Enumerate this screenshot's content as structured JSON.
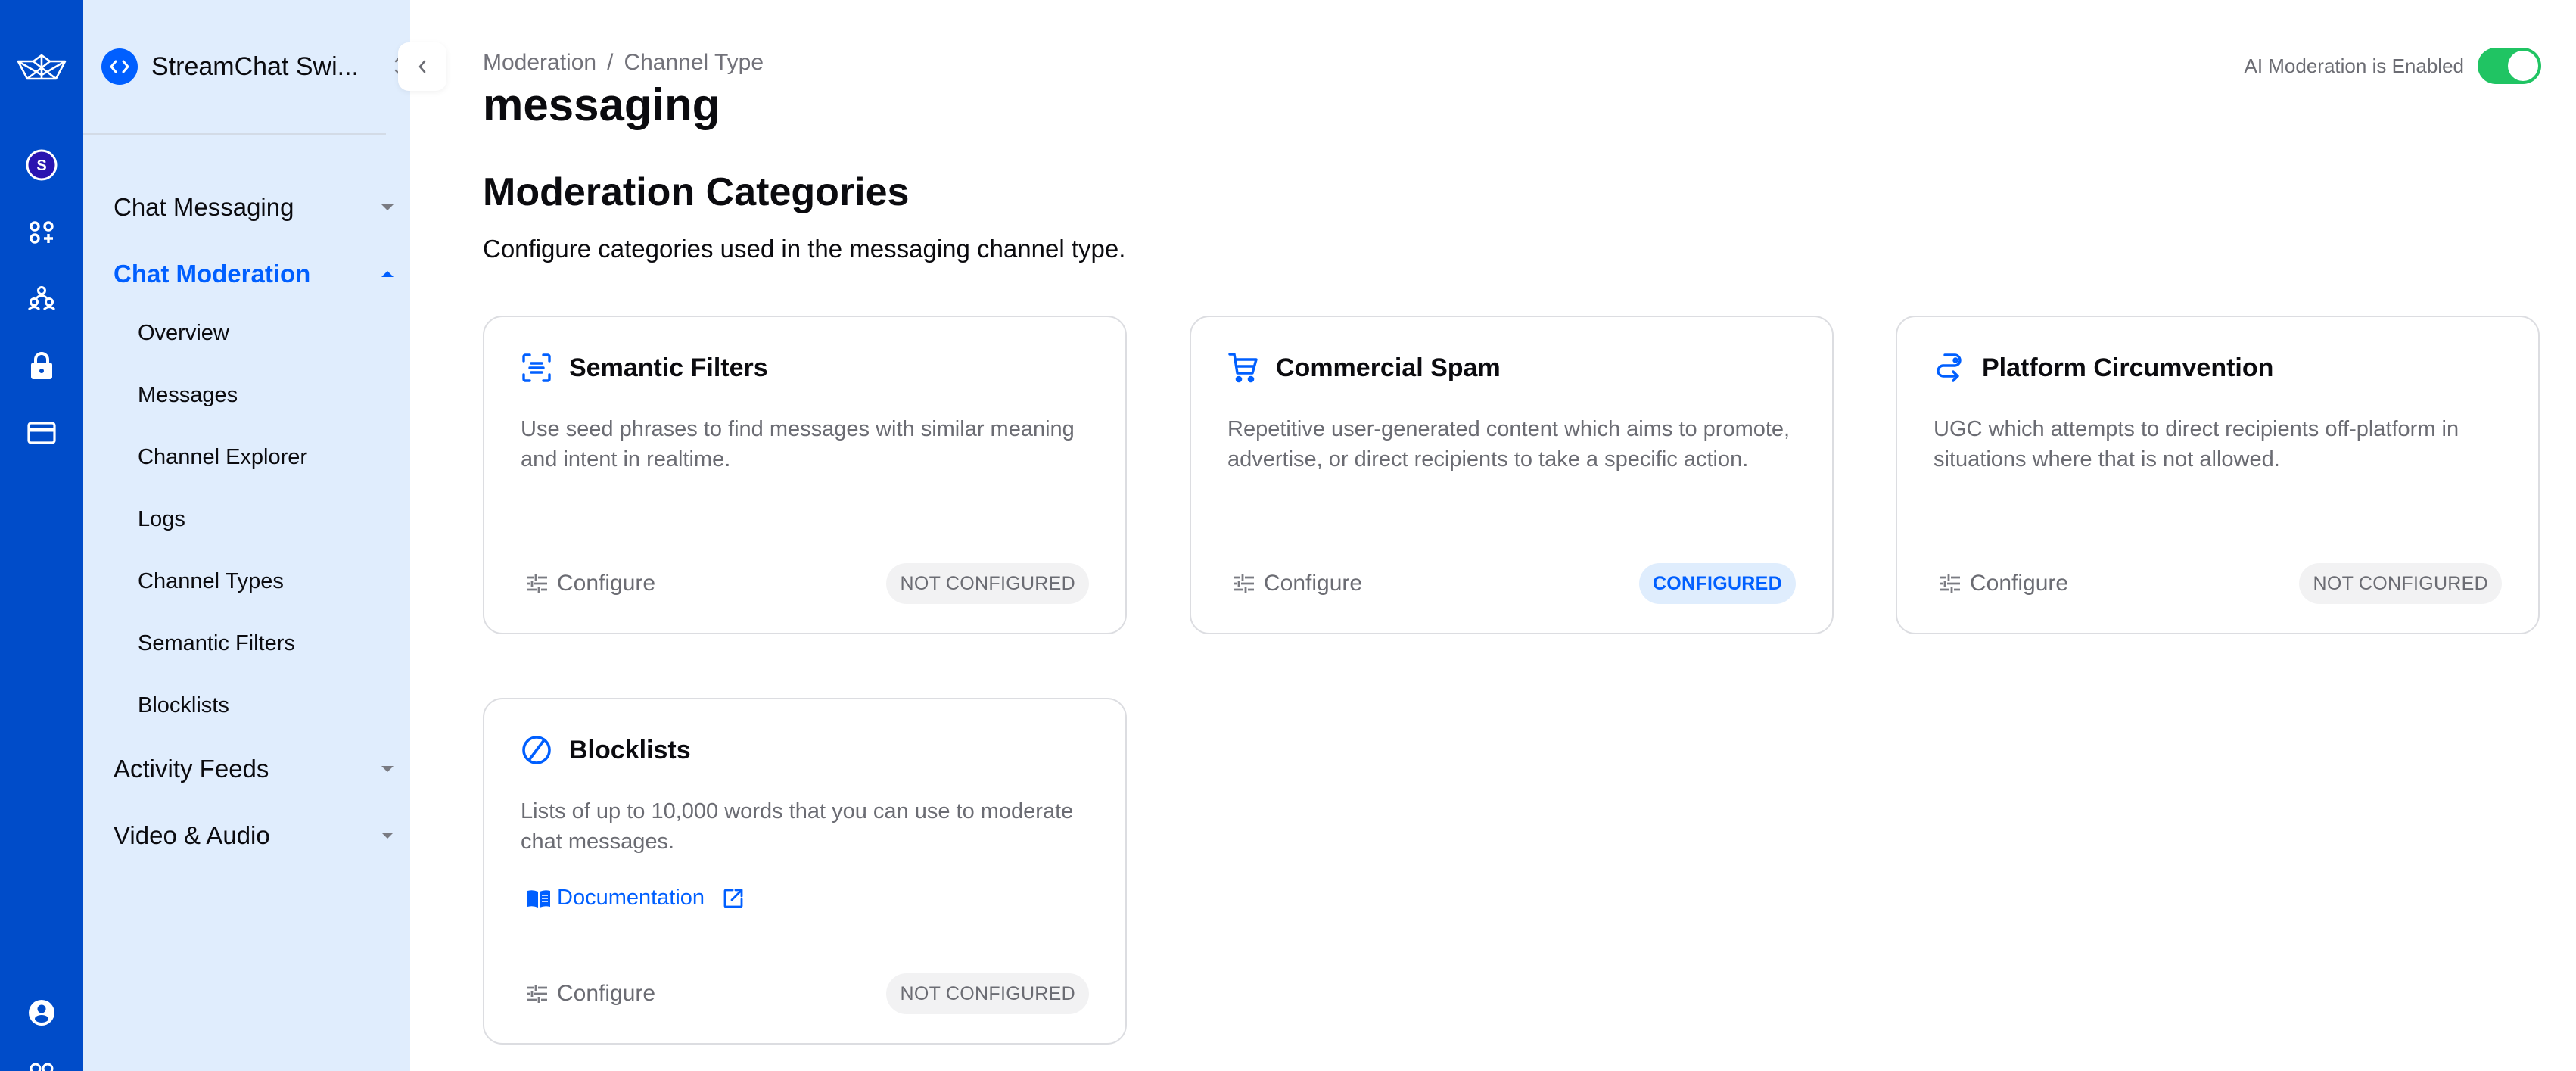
{
  "rail": {
    "icons": [
      "stream-logo-icon",
      "organization-avatar-icon",
      "apps-add-icon",
      "team-icon",
      "lock-icon",
      "billing-card-icon",
      "user-profile-icon"
    ],
    "org_initial": "S"
  },
  "sidebar": {
    "app_name": "StreamChat Swi...",
    "sections": [
      {
        "label": "Chat Messaging",
        "expanded": false,
        "active": false
      },
      {
        "label": "Chat Moderation",
        "expanded": true,
        "active": true
      },
      {
        "label": "Activity Feeds",
        "expanded": false,
        "active": false
      },
      {
        "label": "Video & Audio",
        "expanded": false,
        "active": false
      }
    ],
    "moderation_items": [
      "Overview",
      "Messages",
      "Channel Explorer",
      "Logs",
      "Channel Types",
      "Semantic Filters",
      "Blocklists"
    ]
  },
  "header": {
    "breadcrumb": [
      "Moderation",
      "/",
      "Channel Type"
    ],
    "title": "messaging",
    "ai_moderation_label": "AI Moderation is Enabled",
    "ai_moderation_enabled": true
  },
  "main": {
    "section_title": "Moderation Categories",
    "section_subtitle": "Configure categories used in the messaging channel type.",
    "colors": {
      "accent": "#005fff",
      "toggle_on": "#20c463",
      "rail": "#004cc9",
      "sidebar": "#e0edfd"
    },
    "cards": [
      {
        "icon": "semantic-filter-icon",
        "title": "Semantic Filters",
        "description": "Use seed phrases to find messages with similar meaning and intent in realtime.",
        "configure_label": "Configure",
        "status": "NOT CONFIGURED"
      },
      {
        "icon": "shopping-cart-icon",
        "title": "Commercial Spam",
        "description": "Repetitive user-generated content which aims to promote, advertise, or direct recipients to take a specific action.",
        "configure_label": "Configure",
        "status": "CONFIGURED"
      },
      {
        "icon": "route-redirect-icon",
        "title": "Platform Circumvention",
        "description": "UGC which attempts to direct recipients off-platform in situations where that is not allowed.",
        "configure_label": "Configure",
        "status": "NOT CONFIGURED"
      },
      {
        "icon": "block-icon",
        "title": "Blocklists",
        "description": "Lists of up to 10,000 words that you can use to moderate chat messages.",
        "doc_link_label": "Documentation",
        "configure_label": "Configure",
        "status": "NOT CONFIGURED"
      }
    ]
  }
}
